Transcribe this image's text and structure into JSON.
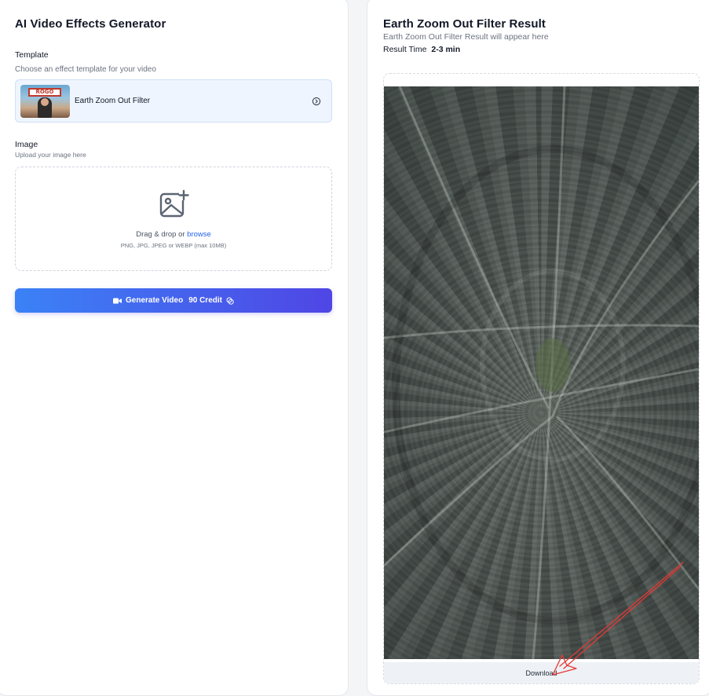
{
  "left_panel": {
    "title": "AI Video Effects Generator",
    "template": {
      "label": "Template",
      "hint": "Choose an effect template for your video",
      "selected_name": "Earth Zoom Out Filter",
      "thumbnail_sign_text": "ROGO"
    },
    "image": {
      "label": "Image",
      "hint": "Upload your image here",
      "drag_text": "Drag & drop or ",
      "browse_link": "browse",
      "formats_hint": "PNG, JPG, JPEG or WEBP (max 10MB)"
    },
    "generate_button": {
      "label": "Generate Video",
      "credit": "90 Credit"
    }
  },
  "right_panel": {
    "title": "Earth Zoom Out Filter Result",
    "subtitle": "Earth Zoom Out Filter Result will appear here",
    "result_time_label": "Result Time",
    "result_time_value": "2-3 min",
    "download_label": "Download"
  },
  "colors": {
    "accent_start": "#3b82f6",
    "accent_end": "#4f46e5",
    "link": "#2563eb",
    "annotation_arrow": "#e53935"
  },
  "icons": {
    "template_arrow": "chevron-right-circle-icon",
    "upload": "image-plus-icon",
    "video": "video-camera-icon",
    "credit": "coins-icon"
  }
}
